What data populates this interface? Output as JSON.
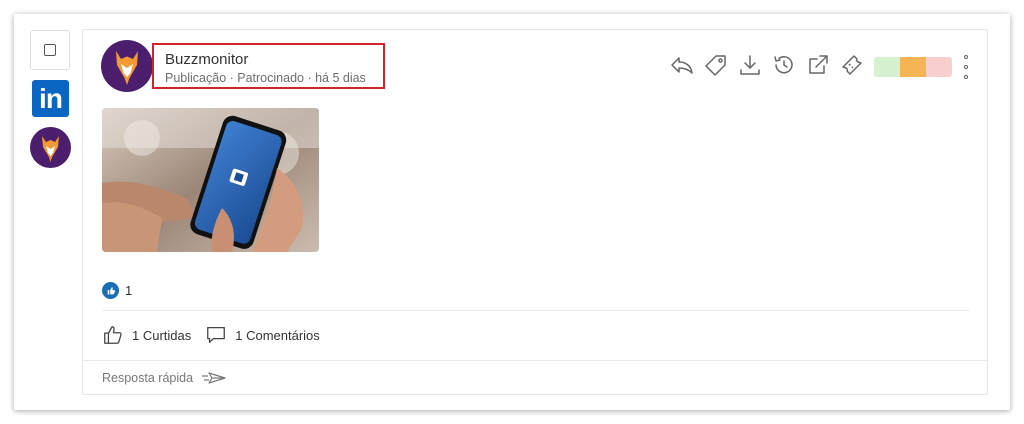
{
  "post": {
    "author": "Buzzmonitor",
    "meta": "Publicação · Patrocinado · há 5 dias",
    "reaction_count": "1",
    "likes_label": "1 Curtidas",
    "comments_label": "1 Comentários",
    "quick_reply_placeholder": "Resposta rápida"
  },
  "network": {
    "logo_text": "in"
  },
  "actions": [
    "reply-icon",
    "tag-icon",
    "download-icon",
    "history-icon",
    "external-link-icon",
    "ticket-icon"
  ],
  "sentiment_colors": {
    "positive": "#d6f1cf",
    "neutral": "#f6b554",
    "negative": "#f8cfcf"
  },
  "colors": {
    "highlight_border": "#d0232a",
    "linkedin": "#0a66c2",
    "avatar_bg": "#4b1f6e",
    "fox": "#f39a33"
  }
}
